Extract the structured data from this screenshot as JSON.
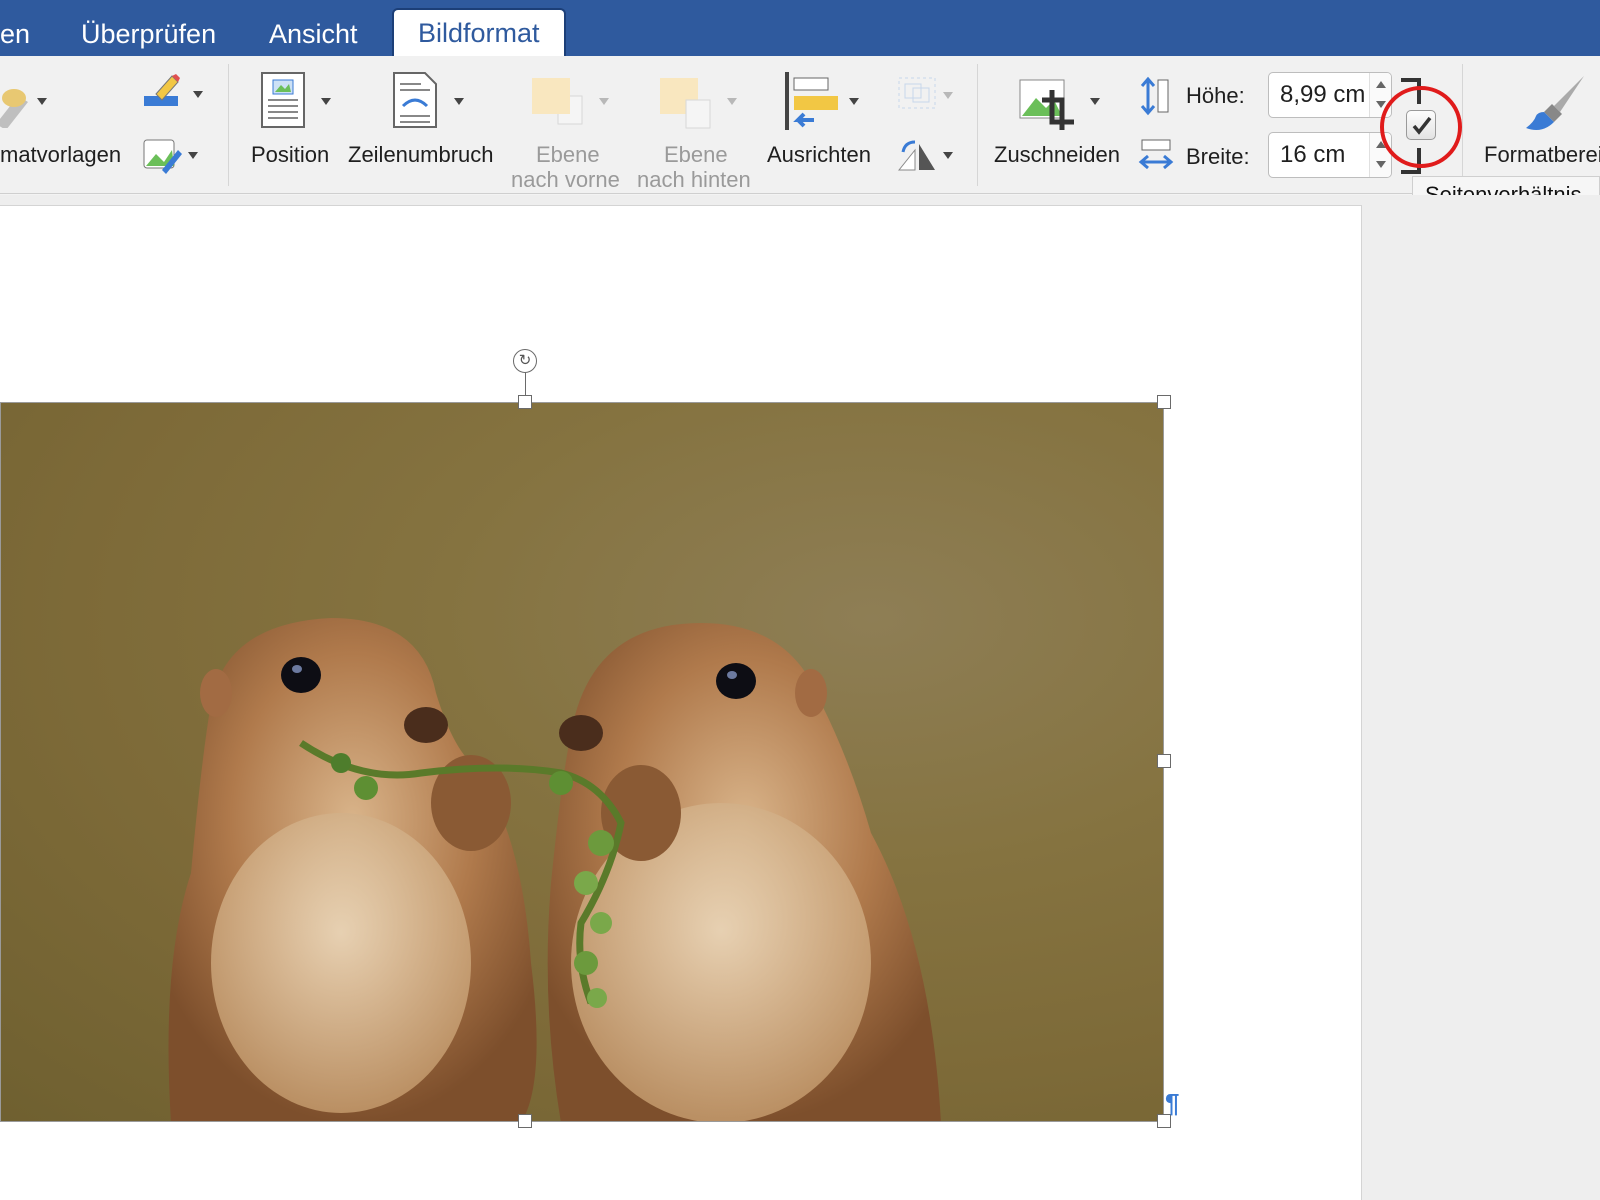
{
  "tabs": [
    {
      "label": "en",
      "active": false
    },
    {
      "label": "Überprüfen",
      "active": false
    },
    {
      "label": "Ansicht",
      "active": false
    },
    {
      "label": "Bildformat",
      "active": true
    }
  ],
  "ribbon": {
    "formatvorlagen_label": "matvorlagen",
    "position_label": "Position",
    "zeilenumbruch_label": "Zeilenumbruch",
    "ebene_vorne_label_1": "Ebene",
    "ebene_vorne_label_2": "nach vorne",
    "ebene_hinten_label_1": "Ebene",
    "ebene_hinten_label_2": "nach hinten",
    "ausrichten_label": "Ausrichten",
    "zuschneiden_label": "Zuschneiden",
    "hoehe_label": "Höhe:",
    "hoehe_value": "8,99 cm",
    "breite_label": "Breite:",
    "breite_value": "16 cm",
    "seitenverhaeltnis_checked": true,
    "tooltip": "Seitenverhältnis",
    "formatbereich_label": "Formatberei"
  },
  "document": {
    "paragraph_mark": "¶",
    "image_subject": "two prairie dogs eating plants"
  },
  "colors": {
    "tab_bar": "#2f5a9e",
    "highlight_circle": "#e01b1b",
    "paragraph_mark": "#3a7bd5"
  }
}
